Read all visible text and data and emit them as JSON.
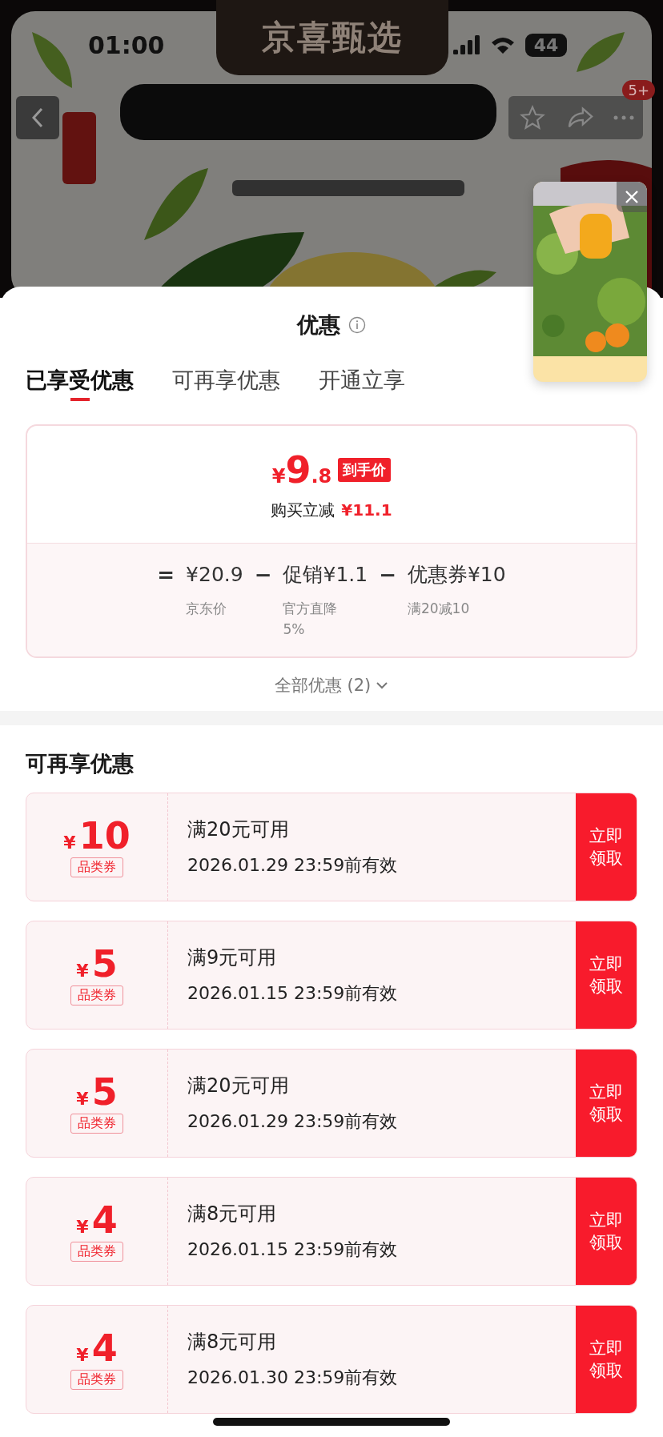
{
  "status_bar": {
    "time": "01:00",
    "battery": "44"
  },
  "header": {
    "title": "京喜甄选",
    "badge": "5+"
  },
  "sheet": {
    "title": "优惠",
    "tabs": [
      {
        "label": "已享受优惠",
        "selected": true
      },
      {
        "label": "可再享优惠",
        "selected": false
      },
      {
        "label": "开通立享",
        "selected": false
      }
    ]
  },
  "summary": {
    "currency": "¥",
    "price_int": "9",
    "price_dec": ".8",
    "price_tag": "到手价",
    "saving_label": "购买立减",
    "saving": "¥11.1",
    "breakdown": [
      {
        "operator": "=",
        "amount": "¥20.9",
        "label": "京东价"
      },
      {
        "operator": "−",
        "amount": "促销¥1.1",
        "label": "官方直降5%"
      },
      {
        "operator": "−",
        "amount": "优惠券¥10",
        "label": "满20减10"
      }
    ]
  },
  "all_offers": "全部优惠 (2)",
  "section_title": "可再享优惠",
  "coupons": [
    {
      "currency": "¥",
      "amount": "10",
      "type": "品类券",
      "condition": "满20元可用",
      "expiry": "2026.01.29 23:59前有效",
      "action": "立即领取"
    },
    {
      "currency": "¥",
      "amount": "5",
      "type": "品类券",
      "condition": "满9元可用",
      "expiry": "2026.01.15 23:59前有效",
      "action": "立即领取"
    },
    {
      "currency": "¥",
      "amount": "5",
      "type": "品类券",
      "condition": "满20元可用",
      "expiry": "2026.01.29 23:59前有效",
      "action": "立即领取"
    },
    {
      "currency": "¥",
      "amount": "4",
      "type": "品类券",
      "condition": "满8元可用",
      "expiry": "2026.01.15 23:59前有效",
      "action": "立即领取"
    },
    {
      "currency": "¥",
      "amount": "4",
      "type": "品类券",
      "condition": "满8元可用",
      "expiry": "2026.01.30 23:59前有效",
      "action": "立即领取"
    }
  ]
}
